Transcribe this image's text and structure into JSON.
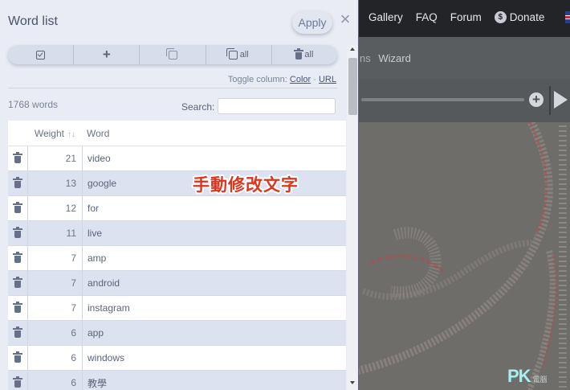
{
  "topnav": {
    "items": [
      "Gallery",
      "FAQ",
      "Forum",
      "Donate"
    ]
  },
  "subnav": {
    "partial": "ns",
    "wizard": "Wizard"
  },
  "panel": {
    "title": "Word list",
    "apply_label": "Apply",
    "close_glyph": "×",
    "toolbar": {
      "add_glyph": "+",
      "copy_all_label": "all",
      "delete_all_label": "all"
    },
    "toggle_column": {
      "label": "Toggle column:",
      "color": "Color",
      "sep": "·",
      "url": "URL"
    },
    "word_count": "1768 words",
    "search": {
      "label": "Search:",
      "value": ""
    },
    "table": {
      "headers": {
        "weight": "Weight",
        "word": "Word",
        "sort_glyph": "↑↓"
      },
      "rows": [
        {
          "weight": "21",
          "word": "video"
        },
        {
          "weight": "13",
          "word": "google"
        },
        {
          "weight": "12",
          "word": "for"
        },
        {
          "weight": "11",
          "word": "live"
        },
        {
          "weight": "7",
          "word": "amp"
        },
        {
          "weight": "7",
          "word": "android"
        },
        {
          "weight": "7",
          "word": "instagram"
        },
        {
          "weight": "6",
          "word": "app"
        },
        {
          "weight": "6",
          "word": "windows"
        },
        {
          "weight": "6",
          "word": "教學"
        }
      ]
    }
  },
  "annotation": "手動修改文字",
  "watermark": {
    "brand": "PK",
    "sub": "電腦"
  },
  "colors": {
    "panel_bg": "#e9ecf4",
    "row_alt": "#dde2f0",
    "annotation": "#e0341c",
    "topbar": "#222428"
  }
}
